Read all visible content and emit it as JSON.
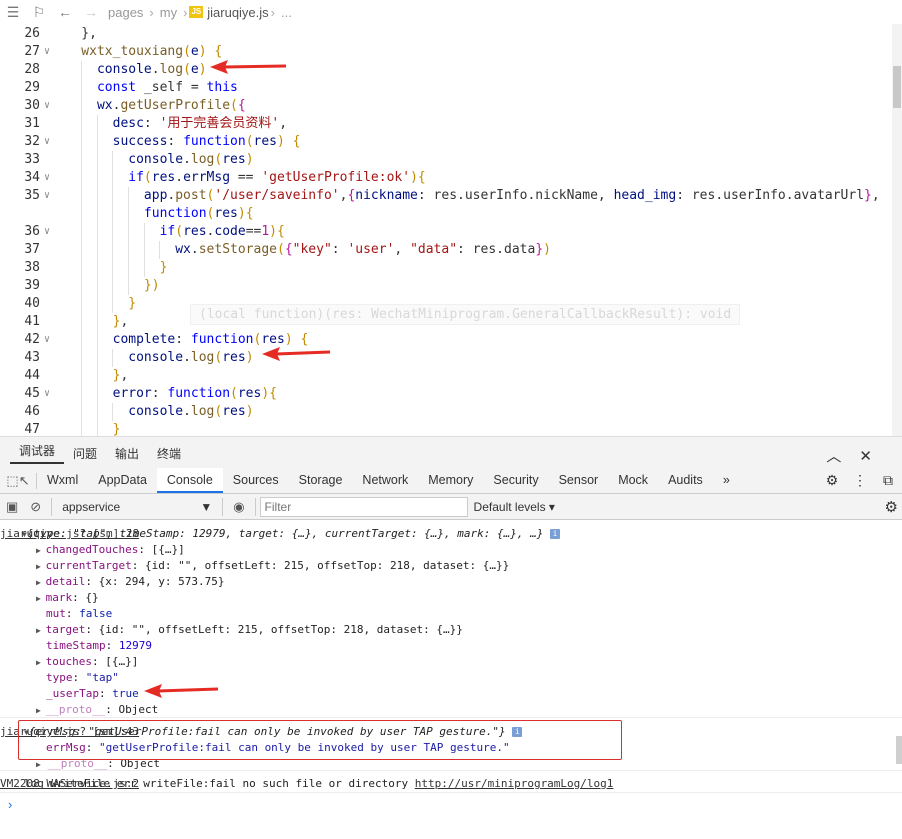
{
  "breadcrumb": {
    "items": [
      "pages",
      "my"
    ],
    "file_badge": "JS",
    "file": "jiaruqiye.js",
    "tail": "..."
  },
  "editor": {
    "lines": [
      {
        "n": "26",
        "fold": false,
        "indent": 0,
        "segs": [
          [
            "p",
            "    },"
          ]
        ]
      },
      {
        "n": "27",
        "fold": true,
        "indent": 0,
        "segs": [
          [
            "f",
            "    wxtx_touxiang"
          ],
          [
            "b1",
            "("
          ],
          [
            "v",
            "e"
          ],
          [
            "b1",
            ")"
          ],
          [
            "p",
            " "
          ],
          [
            "b1",
            "{"
          ]
        ]
      },
      {
        "n": "28",
        "fold": false,
        "indent": 1,
        "segs": [
          [
            "v",
            "      console"
          ],
          [
            "p",
            "."
          ],
          [
            "f",
            "log"
          ],
          [
            "b1",
            "("
          ],
          [
            "v",
            "e"
          ],
          [
            "b1",
            ")"
          ]
        ]
      },
      {
        "n": "29",
        "fold": false,
        "indent": 1,
        "segs": [
          [
            "k",
            "      const"
          ],
          [
            "p",
            " _self = "
          ],
          [
            "k",
            "this"
          ]
        ]
      },
      {
        "n": "30",
        "fold": true,
        "indent": 1,
        "segs": [
          [
            "v",
            "      wx"
          ],
          [
            "p",
            "."
          ],
          [
            "f",
            "getUserProfile"
          ],
          [
            "b1",
            "("
          ],
          [
            "b2",
            "{"
          ]
        ]
      },
      {
        "n": "31",
        "fold": false,
        "indent": 2,
        "segs": [
          [
            "v",
            "        desc"
          ],
          [
            "p",
            ": "
          ],
          [
            "s",
            "'用于完善会员资料'"
          ],
          [
            "p",
            ","
          ]
        ]
      },
      {
        "n": "32",
        "fold": true,
        "indent": 2,
        "segs": [
          [
            "v",
            "        success"
          ],
          [
            "p",
            ": "
          ],
          [
            "k",
            "function"
          ],
          [
            "b1",
            "("
          ],
          [
            "v",
            "res"
          ],
          [
            "b1",
            ")"
          ],
          [
            "p",
            " "
          ],
          [
            "b1",
            "{"
          ]
        ]
      },
      {
        "n": "33",
        "fold": false,
        "indent": 3,
        "segs": [
          [
            "v",
            "          console"
          ],
          [
            "p",
            "."
          ],
          [
            "f",
            "log"
          ],
          [
            "b1",
            "("
          ],
          [
            "v",
            "res"
          ],
          [
            "b1",
            ")"
          ]
        ]
      },
      {
        "n": "34",
        "fold": true,
        "indent": 3,
        "segs": [
          [
            "k",
            "          if"
          ],
          [
            "b1",
            "("
          ],
          [
            "v",
            "res"
          ],
          [
            "p",
            "."
          ],
          [
            "v",
            "errMsg"
          ],
          [
            "p",
            " == "
          ],
          [
            "s",
            "'getUserProfile:ok'"
          ],
          [
            "b1",
            ")"
          ],
          [
            "b1",
            "{"
          ]
        ]
      },
      {
        "n": "35",
        "fold": true,
        "indent": 4,
        "segs": [
          [
            "v",
            "            app"
          ],
          [
            "p",
            "."
          ],
          [
            "f",
            "post"
          ],
          [
            "b1",
            "("
          ],
          [
            "s",
            "'/user/saveinfo'"
          ],
          [
            "p",
            ","
          ],
          [
            "b2",
            "{"
          ],
          [
            "v",
            "nickname"
          ],
          [
            "p",
            ": res.userInfo.nickName, "
          ],
          [
            "v",
            "head_img"
          ],
          [
            "p",
            ": res.userInfo.avatarUrl"
          ],
          [
            "b2",
            "}"
          ],
          [
            "p",
            ","
          ]
        ]
      },
      {
        "n": "",
        "fold": false,
        "indent": 4,
        "segs": [
          [
            "k",
            "            function"
          ],
          [
            "b1",
            "("
          ],
          [
            "v",
            "res"
          ],
          [
            "b1",
            ")"
          ],
          [
            "b1",
            "{"
          ]
        ]
      },
      {
        "n": "36",
        "fold": true,
        "indent": 5,
        "segs": [
          [
            "k",
            "              if"
          ],
          [
            "b1",
            "("
          ],
          [
            "v",
            "res"
          ],
          [
            "p",
            "."
          ],
          [
            "v",
            "code"
          ],
          [
            "p",
            "=="
          ],
          [
            "num",
            "1"
          ],
          [
            "b1",
            ")"
          ],
          [
            "b1",
            "{"
          ]
        ]
      },
      {
        "n": "37",
        "fold": false,
        "indent": 6,
        "segs": [
          [
            "v",
            "                wx"
          ],
          [
            "p",
            "."
          ],
          [
            "f",
            "setStorage"
          ],
          [
            "b1",
            "("
          ],
          [
            "b2",
            "{"
          ],
          [
            "s",
            "\"key\""
          ],
          [
            "p",
            ": "
          ],
          [
            "s",
            "'user'"
          ],
          [
            "p",
            ", "
          ],
          [
            "s",
            "\"data\""
          ],
          [
            "p",
            ": res.data"
          ],
          [
            "b2",
            "}"
          ],
          [
            "b1",
            ")"
          ]
        ]
      },
      {
        "n": "38",
        "fold": false,
        "indent": 5,
        "segs": [
          [
            "b1",
            "              }"
          ]
        ]
      },
      {
        "n": "39",
        "fold": false,
        "indent": 4,
        "segs": [
          [
            "b1",
            "            }"
          ],
          [
            "b1",
            ")"
          ]
        ]
      },
      {
        "n": "40",
        "fold": false,
        "indent": 3,
        "segs": [
          [
            "b1",
            "          }"
          ]
        ]
      },
      {
        "n": "41",
        "fold": false,
        "indent": 2,
        "segs": [
          [
            "b1",
            "        }"
          ],
          [
            "p",
            ","
          ]
        ]
      },
      {
        "n": "42",
        "fold": true,
        "indent": 2,
        "segs": [
          [
            "v",
            "        complete"
          ],
          [
            "p",
            ": "
          ],
          [
            "k",
            "function"
          ],
          [
            "b1",
            "("
          ],
          [
            "v",
            "res"
          ],
          [
            "b1",
            ")"
          ],
          [
            "p",
            " "
          ],
          [
            "b1",
            "{"
          ]
        ]
      },
      {
        "n": "43",
        "fold": false,
        "indent": 3,
        "segs": [
          [
            "v",
            "          console"
          ],
          [
            "p",
            "."
          ],
          [
            "f",
            "log"
          ],
          [
            "b1",
            "("
          ],
          [
            "v",
            "res"
          ],
          [
            "b1",
            ")"
          ]
        ]
      },
      {
        "n": "44",
        "fold": false,
        "indent": 2,
        "segs": [
          [
            "b1",
            "        }"
          ],
          [
            "p",
            ","
          ]
        ]
      },
      {
        "n": "45",
        "fold": true,
        "indent": 2,
        "segs": [
          [
            "v",
            "        error"
          ],
          [
            "p",
            ": "
          ],
          [
            "k",
            "function"
          ],
          [
            "b1",
            "("
          ],
          [
            "v",
            "res"
          ],
          [
            "b1",
            ")"
          ],
          [
            "b1",
            "{"
          ]
        ]
      },
      {
        "n": "46",
        "fold": false,
        "indent": 3,
        "segs": [
          [
            "v",
            "          console"
          ],
          [
            "p",
            "."
          ],
          [
            "f",
            "log"
          ],
          [
            "b1",
            "("
          ],
          [
            "v",
            "res"
          ],
          [
            "b1",
            ")"
          ]
        ]
      },
      {
        "n": "47",
        "fold": false,
        "indent": 2,
        "segs": [
          [
            "b1",
            "        }"
          ]
        ]
      }
    ],
    "hover_hint": "(local function)(res: WechatMiniprogram.GeneralCallbackResult): void"
  },
  "panel": {
    "tabs": [
      "调试器",
      "问题",
      "输出",
      "终端"
    ],
    "active_tab": 0,
    "collapse_icon": "chevron-up-icon",
    "close_icon": "close-icon"
  },
  "devtools": {
    "tabs": [
      "Wxml",
      "AppData",
      "Console",
      "Sources",
      "Storage",
      "Network",
      "Memory",
      "Security",
      "Sensor",
      "Mock",
      "Audits"
    ],
    "active_tab": "Console",
    "more": "»"
  },
  "console_toolbar": {
    "context": "appservice",
    "filter_placeholder": "Filter",
    "levels": "Default levels ▾"
  },
  "console": {
    "entry1": {
      "summary_pre": "{",
      "summary": "type: \"tap\", timeStamp: 12979, target: {…}, currentTarget: {…}, mark: {…}, …}",
      "source": "jiaruqiye.js? [sm]:28",
      "props": [
        {
          "expand": true,
          "key": "changedTouches",
          "value": "[{…}]"
        },
        {
          "expand": true,
          "key": "currentTarget",
          "value": "{id: \"\", offsetLeft: 215, offsetTop: 218, dataset: {…}}"
        },
        {
          "expand": true,
          "key": "detail",
          "value": "{x: 294, y: 573.75}"
        },
        {
          "expand": true,
          "key": "mark",
          "value": "{}"
        },
        {
          "expand": false,
          "key": "mut",
          "value": "false"
        },
        {
          "expand": true,
          "key": "target",
          "value": "{id: \"\", offsetLeft: 215, offsetTop: 218, dataset: {…}}"
        },
        {
          "expand": false,
          "key": "timeStamp",
          "value": "12979"
        },
        {
          "expand": true,
          "key": "touches",
          "value": "[{…}]"
        },
        {
          "expand": false,
          "key": "type",
          "value": "\"tap\""
        },
        {
          "expand": false,
          "key": "_userTap",
          "value": "true"
        },
        {
          "expand": true,
          "key": "__proto__",
          "value": "Object"
        }
      ]
    },
    "entry2": {
      "summary": "{errMsg: \"getUserProfile:fail can only be invoked by user TAP gesture.\"}",
      "source": "jiaruqiye.js? [sm]:43",
      "errmsg_key": "errMsg",
      "errmsg_value": "\"getUserProfile:fail can only be invoked by user TAP gesture.\"",
      "proto_key": "__proto__",
      "proto_value": "Object"
    },
    "entry3": {
      "text": "log writeFile err writeFile:fail no such file or directory ",
      "link": "http://usr/miniprogramLog/log1",
      "source": "VM2208 WAService.js:2"
    },
    "prompt": "›"
  },
  "colors": {
    "accent": "#1a73e8",
    "annotation_arrow": "#e52b23",
    "error_box": "#d9302c"
  }
}
